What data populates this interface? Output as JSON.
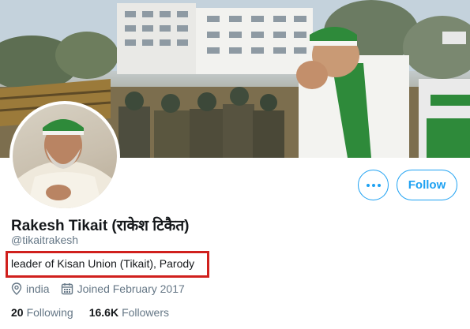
{
  "profile": {
    "display_name": "Rakesh Tikait (राकेश टिकैत)",
    "handle": "@tikaitrakesh",
    "bio": "leader of Kisan Union (Tikait), Parody",
    "location": "india",
    "joined": "Joined February 2017"
  },
  "stats": {
    "following_count": "20",
    "following_label": "Following",
    "followers_count": "16.6K",
    "followers_label": "Followers"
  },
  "actions": {
    "follow_label": "Follow",
    "more_icon": "more-dots-icon"
  },
  "icons": {
    "location": "location-pin-icon",
    "calendar": "calendar-icon"
  },
  "colors": {
    "accent": "#1da1f2",
    "highlight_box": "#d0201d",
    "text_primary": "#14171a",
    "text_secondary": "#657786"
  }
}
